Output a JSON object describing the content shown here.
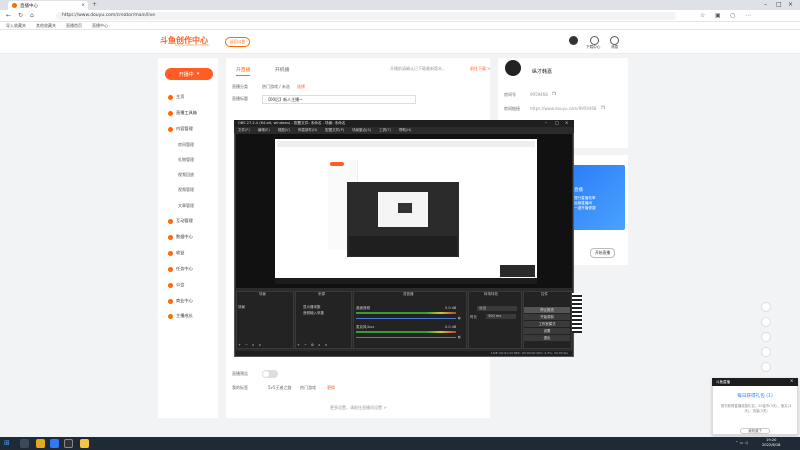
{
  "browser": {
    "tab_title": "直播中心",
    "new_tab": "+",
    "url": "https://www.douyu.com/creator/main/live",
    "bookmarks": [
      "导入收藏夹",
      "其他收藏夹",
      "直播首页",
      "直播中心"
    ]
  },
  "site": {
    "logo_text": "斗鱼创作中心",
    "logo_sub": "DOUYU CREATOR CENTER",
    "back_button": "返回斗鱼",
    "header_icons": [
      {
        "name": "avatar",
        "label": ""
      },
      {
        "name": "download",
        "label": "下载中心"
      },
      {
        "name": "message",
        "label": "消息"
      }
    ]
  },
  "sidebar": {
    "live_button": "开播中",
    "items": [
      {
        "label": "主页",
        "icon": "home-icon"
      },
      {
        "label": "直播工具箱",
        "icon": "toolbox-icon"
      },
      {
        "label": "内容管理",
        "icon": "content-icon"
      },
      {
        "label": "互动管理",
        "icon": "interaction-icon"
      },
      {
        "label": "数据中心",
        "icon": "data-icon"
      },
      {
        "label": "收益",
        "icon": "income-icon"
      },
      {
        "label": "任务中心",
        "icon": "task-icon"
      },
      {
        "label": "公会",
        "icon": "guild-icon"
      },
      {
        "label": "商业中心",
        "icon": "business-icon"
      },
      {
        "label": "主播成长",
        "icon": "growth-icon"
      }
    ],
    "subitems": [
      "房间管理",
      "礼物管理",
      "视频回放",
      "视频管理",
      "文章管理"
    ]
  },
  "main": {
    "tabs": [
      "开直播",
      "开机播"
    ],
    "tab_hint": "开播前请确认已下载最新版本，",
    "tab_hint_link": "前往下载 >",
    "category_label": "直播分类",
    "category_value": "热门游戏 / 未选",
    "category_select": "选择",
    "title_label": "直播标题",
    "title_value": "【00后】新人主播~",
    "toggle_label": "直播预告",
    "bottom_label": "我的标签",
    "bottom_opts": [
      "5v5王者之路",
      "热门游戏",
      "更换"
    ],
    "footer_link": "更多设置，请前往直播间设置 >"
  },
  "right": {
    "streamer_name": "纵才韩嘉",
    "room_label": "房间号",
    "room_value": "9959468",
    "link_label": "房间链接",
    "link_value": "https://www.douyu.com/9959468",
    "banner_title": "直播",
    "banner_lines": [
      "提升直播效率",
      "运营直播间",
      "一键开播便捷"
    ],
    "banner_button": "开始直播"
  },
  "obs": {
    "title": "OBS 27.2.4 (64-bit, windows) - 配置文件: 未命名 - 场景: 未命名",
    "menu": [
      "文件(F)",
      "编辑(E)",
      "视图(V)",
      "停靠部件(D)",
      "配置文件(P)",
      "场景集合(S)",
      "工具(T)",
      "帮助(H)"
    ],
    "docks": [
      "场景",
      "来源",
      "混音器",
      "转场特效",
      "控件"
    ],
    "scenes": [
      "场景"
    ],
    "sources": [
      "显示器采集",
      "音频输入采集"
    ],
    "mixer": [
      {
        "label": "桌面音频",
        "db": "0.0 dB"
      },
      {
        "label": "麦克风/Aux",
        "db": "0.0 dB"
      }
    ],
    "transition": {
      "type": "淡出",
      "duration_label": "时长",
      "duration": "300 ms"
    },
    "controls": [
      "停止推流",
      "开始录制",
      "工作室模式",
      "设置",
      "退出"
    ],
    "status": "LIVE: 00:01:23  REC: 00:00:00  CPU: 2.3%, 30.00 fps",
    "toolbar": [
      "+",
      "−",
      "∧",
      "∨"
    ]
  },
  "popup": {
    "header": "斗鱼直播",
    "title": "每日获得礼包 (1)",
    "text": "首次获得直播奖励礼包，20金币(3天)，鱼丸(3天)，流量(3天)",
    "button": "我知道了"
  },
  "taskbar": {
    "time": "19:20",
    "date": "2022/6/18"
  }
}
